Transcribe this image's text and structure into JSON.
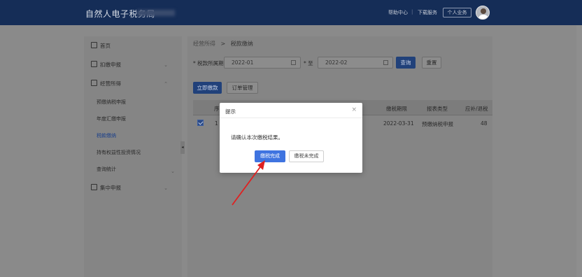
{
  "header": {
    "app_title": "自然人电子税务局",
    "help_center": "帮助中心",
    "download_service": "下载服务",
    "personal_business": "个人业务",
    "separator": "|"
  },
  "sidebar": {
    "home": "首页",
    "withholding": "扣缴申报",
    "operating_income": "经营所得",
    "sub_items": [
      "预缴纳税申报",
      "年度汇缴申报",
      "税款缴纳",
      "持有权益性投资情况",
      "查询统计"
    ],
    "centralized": "集中申报",
    "chevron": "⌄",
    "chevron_up": "⌃",
    "collapse_handle": "◂"
  },
  "breadcrumb": {
    "parent": "经营所得",
    "separator": ">",
    "current": "税款缴纳"
  },
  "filter": {
    "period_label": "* 税款所属期",
    "to_label": "* 至",
    "start_date": "2022-01",
    "end_date": "2022-02",
    "query_button": "查询",
    "reset_button": "重置"
  },
  "actions": {
    "pay_now": "立即缴款",
    "order_manage": "订单管理"
  },
  "table": {
    "headers": [
      "序",
      "缴税期限",
      "报表类型",
      "应补/退税"
    ],
    "row": {
      "index": "1",
      "deadline": "2022-03-31",
      "report_type": "预缴纳税申报",
      "amount": "48"
    }
  },
  "modal": {
    "title": "提示",
    "close": "×",
    "message": "请确认本次缴税结果。",
    "confirm_button": "缴税完成",
    "cancel_button": "缴税未完成"
  },
  "colors": {
    "header_bg": "#152d57",
    "primary": "#3f74e0",
    "arrow": "#e02020"
  }
}
